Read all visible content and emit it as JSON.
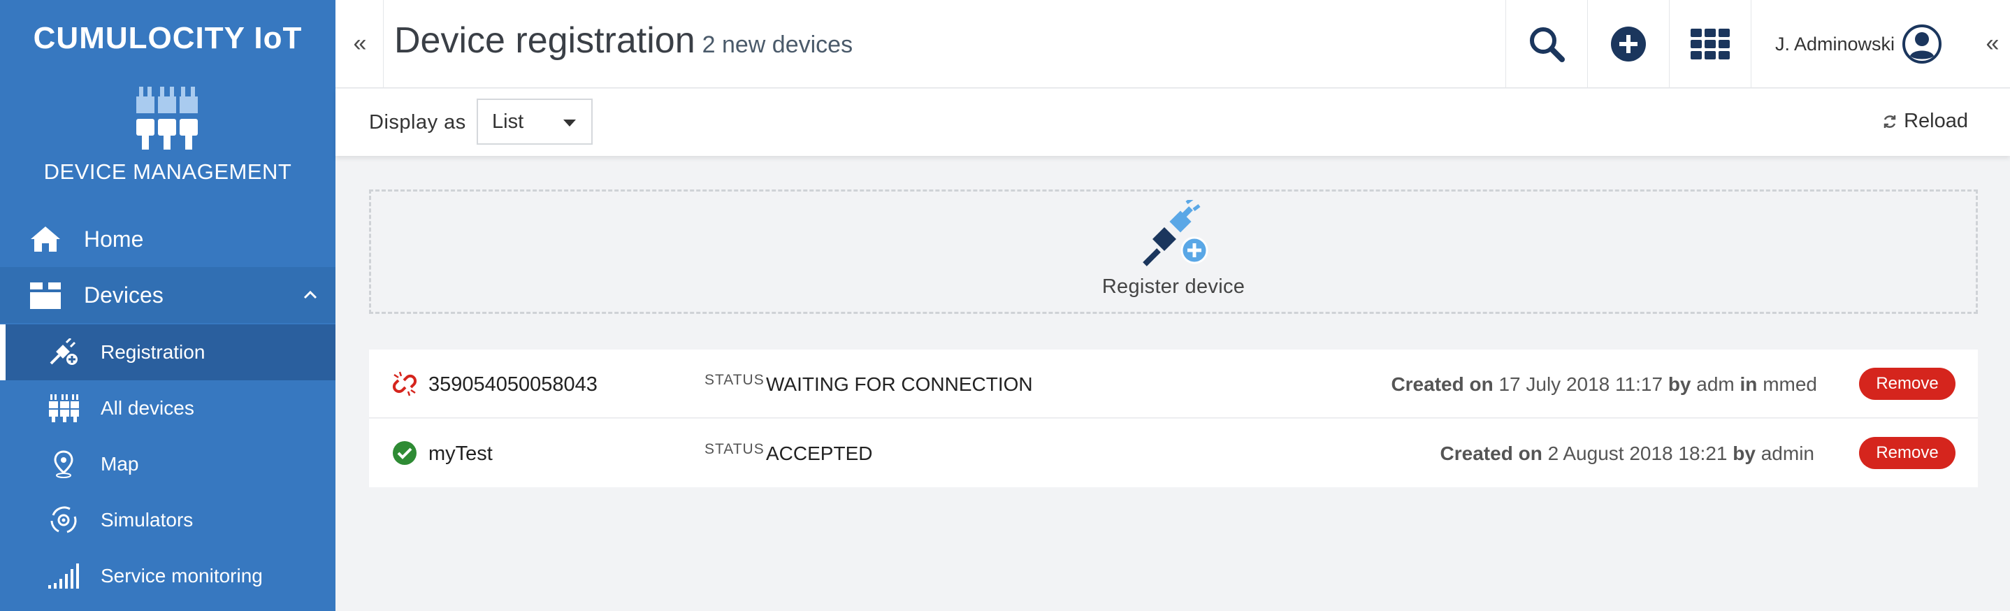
{
  "sidebar": {
    "brand": "CUMULOCITY IoT",
    "app_name": "DEVICE MANAGEMENT",
    "home_label": "Home",
    "devices_label": "Devices",
    "items": [
      {
        "label": "Registration",
        "icon": "plug-add-icon"
      },
      {
        "label": "All devices",
        "icon": "devices-icon"
      },
      {
        "label": "Map",
        "icon": "map-pin-icon"
      },
      {
        "label": "Simulators",
        "icon": "simulator-icon"
      },
      {
        "label": "Service monitoring",
        "icon": "signal-bars-icon"
      }
    ]
  },
  "header": {
    "title": "Device registration",
    "subtitle": "2 new devices",
    "user_name": "J. Adminowski"
  },
  "toolbar": {
    "display_label": "Display as",
    "display_value": "List",
    "reload_label": "Reload"
  },
  "register": {
    "label": "Register device"
  },
  "devices": [
    {
      "name": "359054050058043",
      "status_key": "STATUS",
      "status": "WAITING FOR CONNECTION",
      "created_on_label": "Created on",
      "created_date": "17 July 2018 11:17",
      "by_label": "by",
      "by_user": "adm",
      "in_label": "in",
      "tenant": "mmed",
      "remove_label": "Remove",
      "status_color": "#d5251d"
    },
    {
      "name": "myTest",
      "status_key": "STATUS",
      "status": "ACCEPTED",
      "created_on_label": "Created on",
      "created_date": "2 August 2018 18:21",
      "by_label": "by",
      "by_user": "admin",
      "remove_label": "Remove",
      "status_color": "#2e8b34"
    }
  ],
  "colors": {
    "sidebar": "#3778c0",
    "sidebar_active": "#2a5f9e",
    "accent": "#1b365d",
    "danger": "#d5251d"
  }
}
